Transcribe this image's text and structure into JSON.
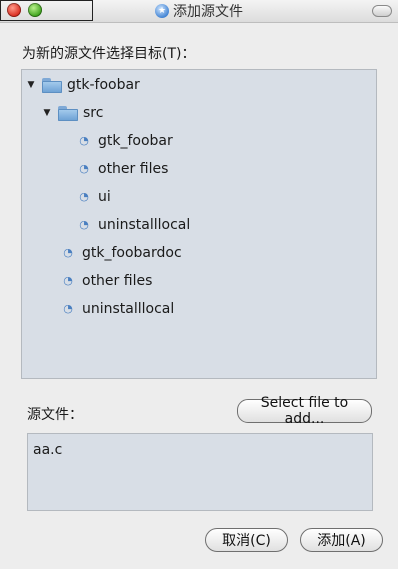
{
  "window": {
    "title": "添加源文件",
    "app_icon": "star-icon"
  },
  "prompt": {
    "label": "为新的源文件选择目标(T)："
  },
  "tree": {
    "items": [
      {
        "label": "gtk-foobar",
        "type": "folder",
        "expanded": true
      },
      {
        "label": "src",
        "type": "folder",
        "expanded": true
      },
      {
        "label": "gtk_foobar",
        "type": "target"
      },
      {
        "label": "other files",
        "type": "target"
      },
      {
        "label": "ui",
        "type": "target"
      },
      {
        "label": "uninstalllocal",
        "type": "target"
      },
      {
        "label": "gtk_foobardoc",
        "type": "target"
      },
      {
        "label": "other files",
        "type": "target"
      },
      {
        "label": "uninstalllocal",
        "type": "target"
      }
    ]
  },
  "source": {
    "label": "源文件：",
    "select_button": "Select file to add...",
    "files": [
      "aa.c"
    ]
  },
  "buttons": {
    "cancel": "取消(C)",
    "add": "添加(A)"
  }
}
